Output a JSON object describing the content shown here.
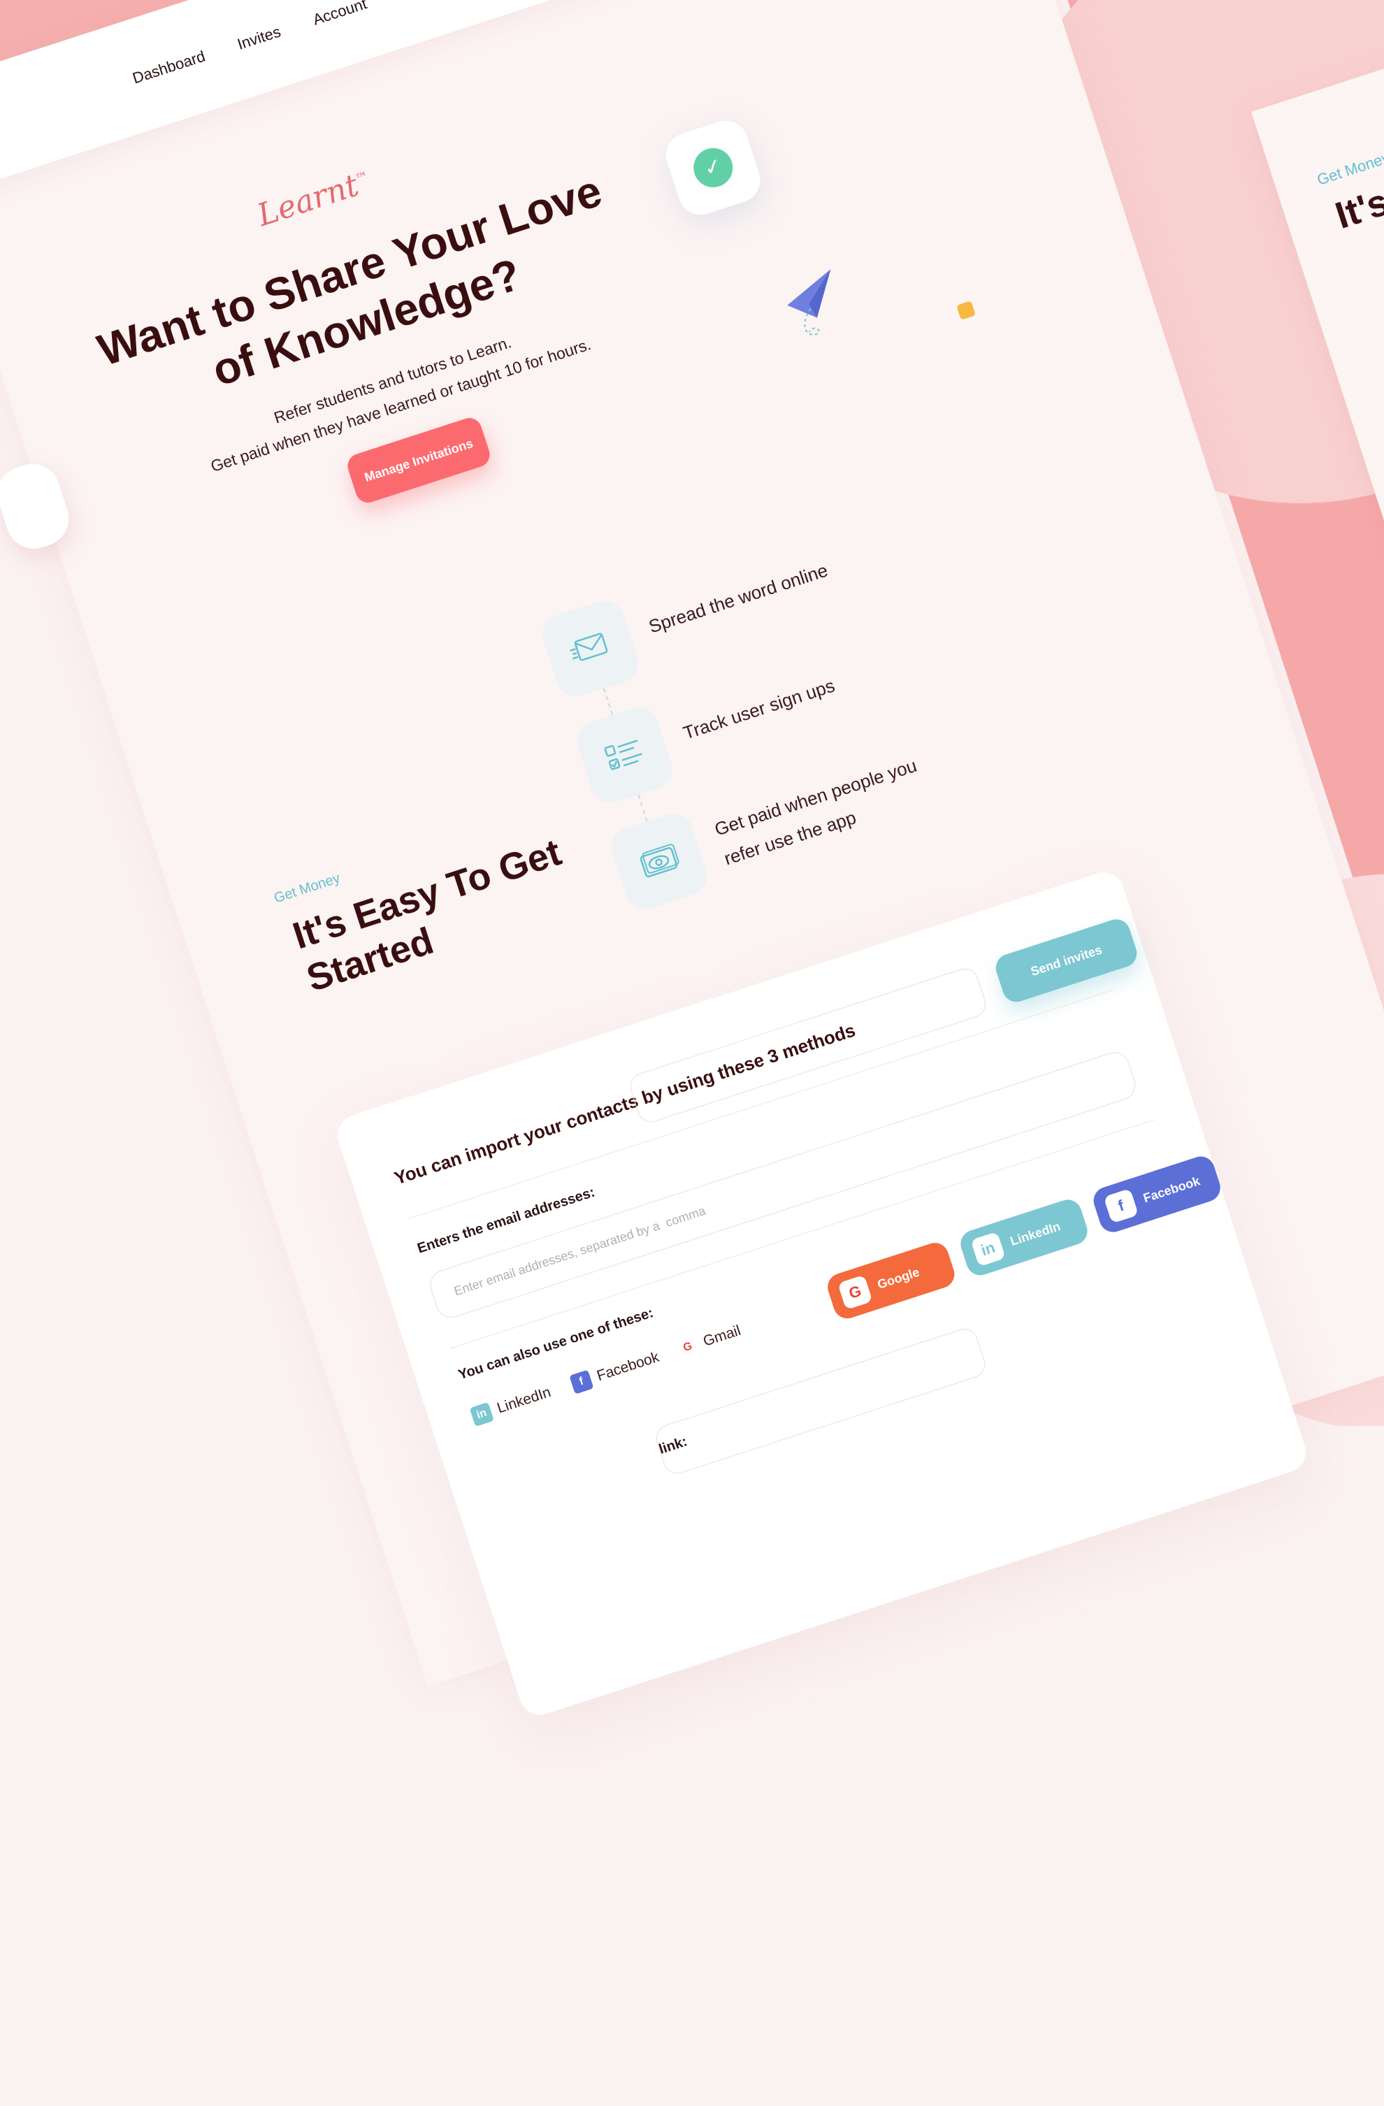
{
  "nav": {
    "items": [
      "Dashboard",
      "Invites",
      "Account"
    ]
  },
  "brand": {
    "logo": "Learnt",
    "tm": "™"
  },
  "hero": {
    "title": "Want to Share Your Love of Knowledge?",
    "line1": "Refer students and tutors to Learn.",
    "line2": "Get paid when they have learned or taught 10 for hours.",
    "cta": "Manage Invitations"
  },
  "steps": [
    {
      "text": "Spread the word online",
      "icon": "envelope-icon"
    },
    {
      "text": "Track user sign ups",
      "icon": "checklist-icon"
    },
    {
      "text": "Get paid when people you refer use the app",
      "icon": "money-icon"
    }
  ],
  "section": {
    "eyebrow": "Get Money",
    "title": "It's Easy To Get Started"
  },
  "import": {
    "heading": "You can import your contacts by using these 3 methods",
    "send": "Send invites",
    "email_label": "Enters the email addresses:",
    "email_placeholder": "Enter email addresses, separated by a  comma",
    "also_label": "You can also use one of these:",
    "mini": [
      "LinkedIn",
      "Facebook",
      "Gmail"
    ],
    "link_label": "link:",
    "buttons": [
      "Google",
      "LinkedIn",
      "Facebook"
    ]
  },
  "right_card": {
    "eyebrow": "Get Money",
    "title": "It's E Sta"
  },
  "colors": {
    "accent": "#fb6a6f",
    "teal": "#7cc7d2",
    "facebook": "#5b6fd6",
    "google": "#f46a3c",
    "heading": "#3a0e0f",
    "check": "#62d0a6",
    "band": "#f6a9a9"
  }
}
